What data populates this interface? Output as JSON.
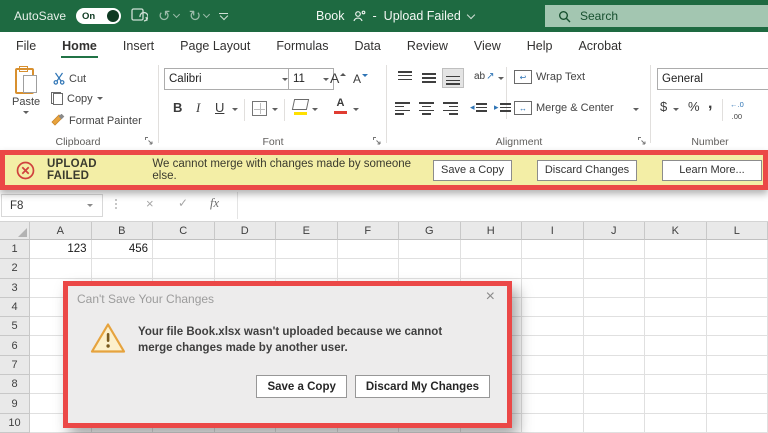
{
  "colors": {
    "excel_green": "#1E6A41",
    "search_bg": "#A3C6B1",
    "search_text": "#17502F",
    "tab_accent": "#217346",
    "annotation_red": "#EB4847",
    "message_yellow": "#F3EEA6",
    "dialog_bg": "#EDECEC"
  },
  "glyphs": {
    "undo": "↺",
    "redo": "↻",
    "check": "✓",
    "cancel": "×"
  },
  "title_bar": {
    "autosave_label": "AutoSave",
    "autosave_state": "On",
    "doc_title": "Book",
    "separator": "-",
    "status": "Upload Failed",
    "search_placeholder": "Search"
  },
  "tabs": {
    "items": [
      {
        "label": "File"
      },
      {
        "label": "Home",
        "active": true
      },
      {
        "label": "Insert"
      },
      {
        "label": "Page Layout"
      },
      {
        "label": "Formulas"
      },
      {
        "label": "Data"
      },
      {
        "label": "Review"
      },
      {
        "label": "View"
      },
      {
        "label": "Help"
      },
      {
        "label": "Acrobat"
      }
    ]
  },
  "ribbon": {
    "clipboard": {
      "label": "Clipboard",
      "paste_label": "Paste",
      "cut_label": "Cut",
      "copy_label": "Copy",
      "format_painter_label": "Format Painter"
    },
    "font": {
      "label": "Font",
      "family": "Calibri",
      "size": "11",
      "bold": "B",
      "italic": "I",
      "underline": "U",
      "increase_size": "A",
      "decrease_size": "A",
      "color_letter": "A"
    },
    "alignment": {
      "label": "Alignment",
      "orientation": "ab",
      "wrap_text": "Wrap Text",
      "wrap_icon_text": "ab",
      "merge_center": "Merge & Center",
      "merge_icon_text": "↔"
    },
    "number": {
      "label": "Number",
      "format": "General",
      "currency": "$",
      "percent": "%",
      "comma": ",",
      "increase_decimal_top": "←.0",
      "increase_decimal_bottom": ".00"
    }
  },
  "message_bar": {
    "title": "UPLOAD FAILED",
    "message": "We cannot merge with changes made by someone else.",
    "buttons": {
      "save_a_copy": "Save a Copy",
      "discard_changes": "Discard Changes",
      "learn_more": "Learn More..."
    }
  },
  "formula_bar": {
    "name_box": "F8",
    "fx_label": "fx"
  },
  "grid": {
    "columns": [
      "A",
      "B",
      "C",
      "D",
      "E",
      "F",
      "G",
      "H",
      "I",
      "J",
      "K",
      "L"
    ],
    "rows": [
      "1",
      "2",
      "3",
      "4",
      "5",
      "6",
      "7",
      "8",
      "9",
      "10"
    ],
    "cells": {
      "A1": "123",
      "B1": "456"
    }
  },
  "dialog": {
    "title": "Can't Save Your Changes",
    "message": "Your file Book.xlsx wasn't uploaded because we cannot merge changes made by another user.",
    "buttons": {
      "save_a_copy": "Save a Copy",
      "discard": "Discard My Changes"
    }
  }
}
